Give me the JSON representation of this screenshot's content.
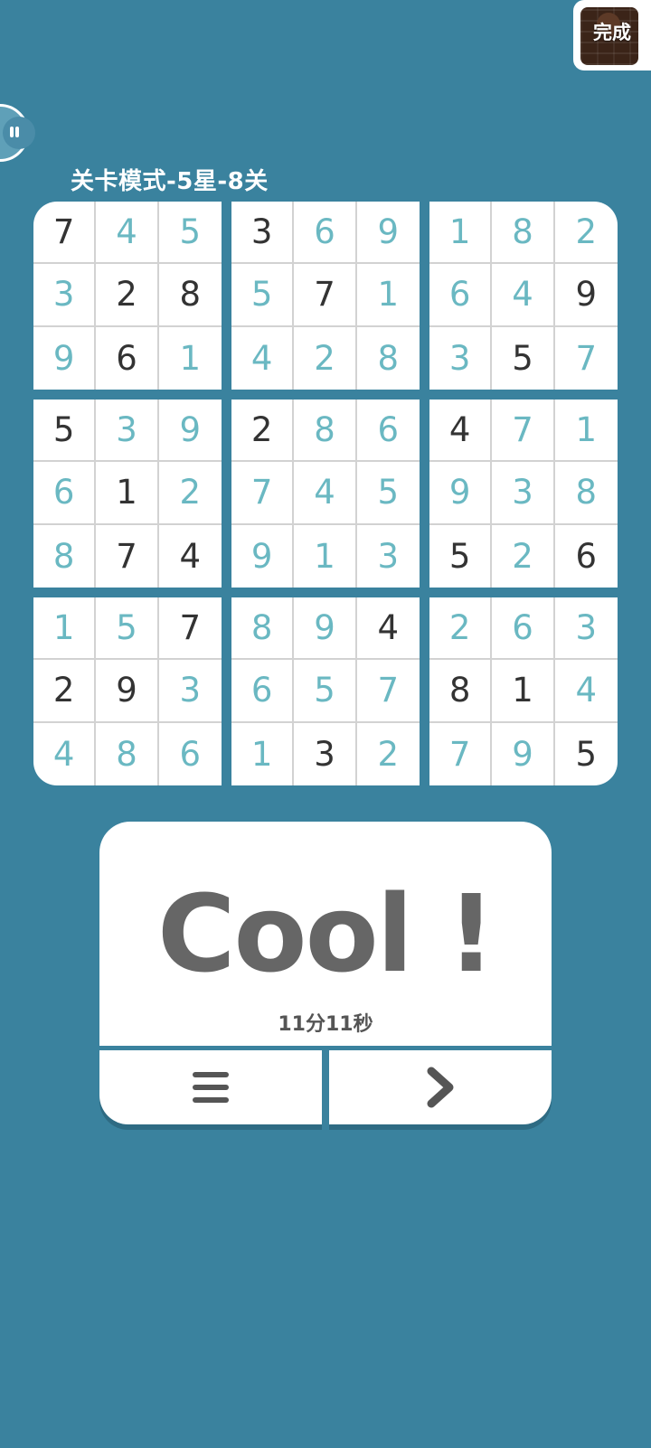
{
  "done_badge": {
    "label": "完成"
  },
  "level_title": "关卡模式-5星-8关",
  "colors": {
    "background": "#3a829e",
    "given_digit": "#333333",
    "filled_digit": "#6ab8c2",
    "card": "#ffffff",
    "cool_text": "#666666"
  },
  "sudoku": {
    "grid": [
      [
        7,
        4,
        5,
        3,
        6,
        9,
        1,
        8,
        2
      ],
      [
        3,
        2,
        8,
        5,
        7,
        1,
        6,
        4,
        9
      ],
      [
        9,
        6,
        1,
        4,
        2,
        8,
        3,
        5,
        7
      ],
      [
        5,
        3,
        9,
        2,
        8,
        6,
        4,
        7,
        1
      ],
      [
        6,
        1,
        2,
        7,
        4,
        5,
        9,
        3,
        8
      ],
      [
        8,
        7,
        4,
        9,
        1,
        3,
        5,
        2,
        6
      ],
      [
        1,
        5,
        7,
        8,
        9,
        4,
        2,
        6,
        3
      ],
      [
        2,
        9,
        3,
        6,
        5,
        7,
        8,
        1,
        4
      ],
      [
        4,
        8,
        6,
        1,
        3,
        2,
        7,
        9,
        5
      ]
    ],
    "given": [
      [
        1,
        0,
        0,
        1,
        0,
        0,
        0,
        0,
        0
      ],
      [
        0,
        1,
        1,
        0,
        1,
        0,
        0,
        0,
        1
      ],
      [
        0,
        1,
        0,
        0,
        0,
        0,
        0,
        1,
        0
      ],
      [
        1,
        0,
        0,
        1,
        0,
        0,
        1,
        0,
        0
      ],
      [
        0,
        1,
        0,
        0,
        0,
        0,
        0,
        0,
        0
      ],
      [
        0,
        1,
        1,
        0,
        0,
        0,
        1,
        0,
        1
      ],
      [
        0,
        0,
        1,
        0,
        0,
        1,
        0,
        0,
        0
      ],
      [
        1,
        1,
        0,
        0,
        0,
        0,
        1,
        1,
        0
      ],
      [
        0,
        0,
        0,
        0,
        1,
        0,
        0,
        0,
        1
      ]
    ]
  },
  "result": {
    "message": "Cool !",
    "time": "11分11秒"
  },
  "buttons": [
    {
      "name": "menu-button",
      "icon": "menu-icon"
    },
    {
      "name": "next-button",
      "icon": "chevron-right-icon"
    }
  ]
}
